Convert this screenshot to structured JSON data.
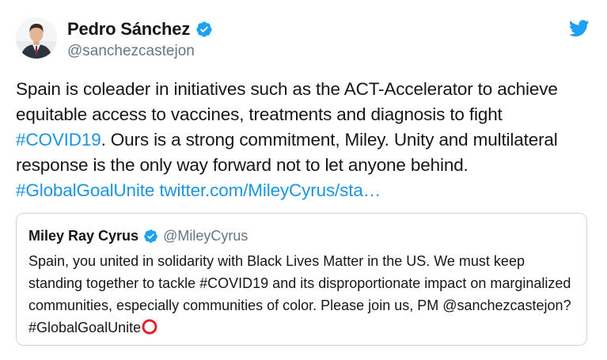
{
  "tweet": {
    "author": {
      "name": "Pedro Sánchez",
      "handle": "@sanchezcastejon"
    },
    "text": {
      "part1": "Spain is coleader in initiatives such as the ACT-Accelerator to achieve equitable access to vaccines, treatments and diagnosis to fight ",
      "hashtag1": "#COVID19",
      "part2": ". Ours is a strong commitment, Miley. Unity and multilateral response is the only way forward not to let anyone behind.",
      "hashtag2": "#GlobalGoalUnite",
      "link": "twitter.com/MileyCyrus/sta…"
    },
    "quoted": {
      "name": "Miley Ray Cyrus",
      "handle": "@MileyCyrus",
      "text": "Spain, you united in solidarity with Black Lives Matter in the US. We must keep standing together to tackle #COVID19 and its disproportionate impact on marginalized communities, especially communities of color. Please join us, PM @sanchezcastejon? #GlobalGoalUnite"
    }
  },
  "icons": {
    "verified": "verified-badge-icon",
    "brand": "twitter-bird-icon",
    "emoji": "hollow-red-circle-icon"
  },
  "colors": {
    "link": "#1b95e0",
    "verified": "#1da1f2",
    "handle": "#657786",
    "border": "#ccd6dd",
    "emoji_red": "#e0202c"
  }
}
